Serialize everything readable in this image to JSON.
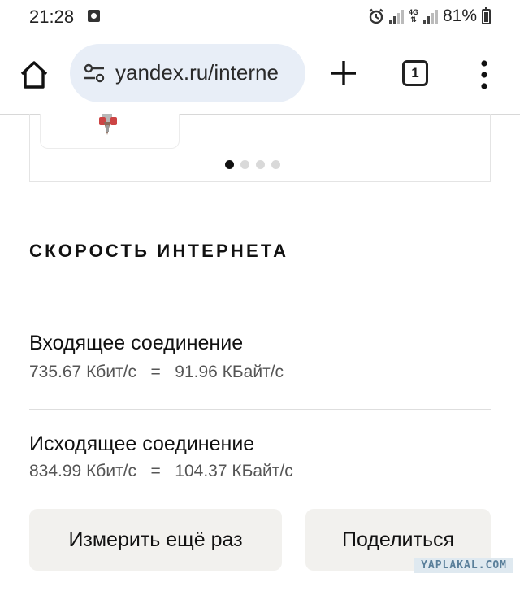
{
  "status_bar": {
    "time": "21:28",
    "battery": "81%",
    "network": "4G",
    "icons": [
      "photo-icon",
      "alarm-icon",
      "signal-icon",
      "battery-icon"
    ]
  },
  "browser": {
    "url": "yandex.ru/interne",
    "tab_count": "1",
    "icons": [
      "home-icon",
      "site-settings-icon",
      "new-tab-icon",
      "more-icon"
    ]
  },
  "carousel": {
    "dots_total": 4,
    "active_index": 0
  },
  "speed": {
    "title": "СКОРОСТЬ ИНТЕРНЕТА",
    "download": {
      "label": "Входящее соединение",
      "value": "735.67 Кбит/с   =   91.96 КБайт/с"
    },
    "upload": {
      "label": "Исходящее соединение",
      "value": "834.99 Кбит/с   =   104.37 КБайт/с"
    }
  },
  "actions": {
    "remeasure": "Измерить ещё раз",
    "share": "Поделиться"
  },
  "watermark": "YAPLAKAL.COM",
  "colors": {
    "url_bar_bg": "#e8eef7",
    "button_bg": "#f2f1ee",
    "active_dot": "#111111"
  }
}
